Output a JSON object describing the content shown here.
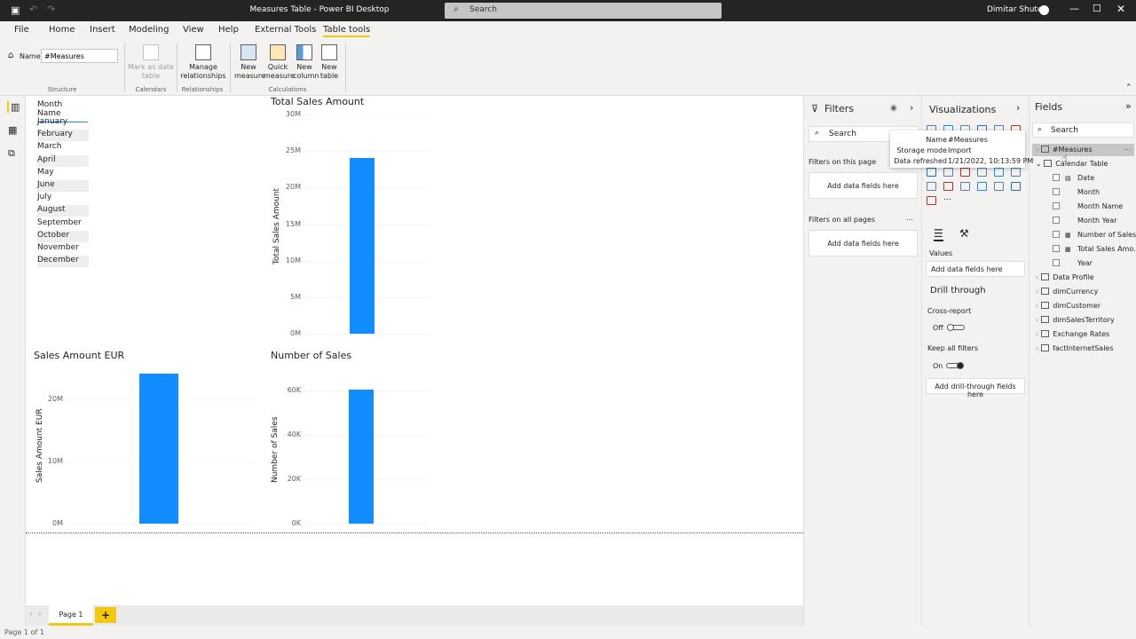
{
  "window": {
    "title": "Measures Table - Power BI Desktop",
    "search_placeholder": "Search",
    "user": "Dimitar Shutev"
  },
  "ribbon": {
    "tabs": [
      "File",
      "Home",
      "Insert",
      "Modeling",
      "View",
      "Help",
      "External Tools",
      "Table tools"
    ],
    "active_tab": "Table tools",
    "name_label": "Name",
    "name_value": "#Measures",
    "groups": {
      "structure": "Structure",
      "calendars": "Calendars",
      "relationships": "Relationships",
      "calculations": "Calculations"
    },
    "buttons": {
      "mark_as_date": "Mark as date table",
      "manage_relationships": "Manage relationships",
      "new_measure": "New measure",
      "quick_measure": "Quick measure",
      "new_column": "New column",
      "new_table": "New table"
    }
  },
  "slicer": {
    "header": "Month Name",
    "items": [
      "January",
      "February",
      "March",
      "April",
      "May",
      "June",
      "July",
      "August",
      "September",
      "October",
      "November",
      "December"
    ]
  },
  "chart_data": [
    {
      "type": "bar",
      "title": "Total Sales Amount",
      "ylabel": "Total Sales Amount",
      "xlabel": "",
      "ylim": [
        0,
        30000000
      ],
      "ticks": [
        "0M",
        "5M",
        "10M",
        "15M",
        "20M",
        "25M",
        "30M"
      ],
      "values": [
        24050000
      ],
      "color": "#118dff"
    },
    {
      "type": "bar",
      "title": "Sales Amount EUR",
      "ylabel": "Sales Amount EUR",
      "xlabel": "",
      "ylim": [
        0,
        24000000
      ],
      "ticks": [
        "0M",
        "10M",
        "20M"
      ],
      "tick_values": [
        0,
        10000000,
        20000000
      ],
      "values": [
        24100000
      ],
      "color": "#118dff"
    },
    {
      "type": "bar",
      "title": "Number of Sales",
      "ylabel": "Number of Sales",
      "xlabel": "",
      "ylim": [
        0,
        66000
      ],
      "ticks": [
        "0K",
        "20K",
        "40K",
        "60K"
      ],
      "tick_values": [
        0,
        20000,
        40000,
        60000
      ],
      "values": [
        60400
      ],
      "color": "#118dff"
    }
  ],
  "pages": {
    "tabs": [
      "Page 1"
    ],
    "add": "+",
    "status": "Page 1 of 1"
  },
  "filters": {
    "title": "Filters",
    "search": "Search",
    "on_this_page": "Filters on this page",
    "on_all_pages": "Filters on all pages",
    "add": "Add data fields here"
  },
  "visualizations": {
    "title": "Visualizations",
    "values": "Values",
    "add": "Add data fields here",
    "drill_through": "Drill through",
    "cross_report": "Cross-report",
    "cross_state": "Off",
    "keep_filters": "Keep all filters",
    "keep_state": "On",
    "add_drill": "Add drill-through fields here"
  },
  "tooltip": {
    "name_k": "Name",
    "name_v": "#Measures",
    "mode_k": "Storage mode",
    "mode_v": "Import",
    "refresh_k": "Data refreshed",
    "refresh_v": "1/21/2022, 10:13:59 PM"
  },
  "fields": {
    "title": "Fields",
    "search": "Search",
    "measures": "#Measures",
    "calendar": "Calendar Table",
    "calendar_cols": [
      "Date",
      "Month",
      "Month Name",
      "Month Year",
      "Number of Sales",
      "Total Sales Amo...",
      "Year"
    ],
    "tables": [
      "Data Profile",
      "dimCurrency",
      "dimCustomer",
      "dimSalesTerritory",
      "Exchange Rates",
      "factInternetSales"
    ]
  }
}
